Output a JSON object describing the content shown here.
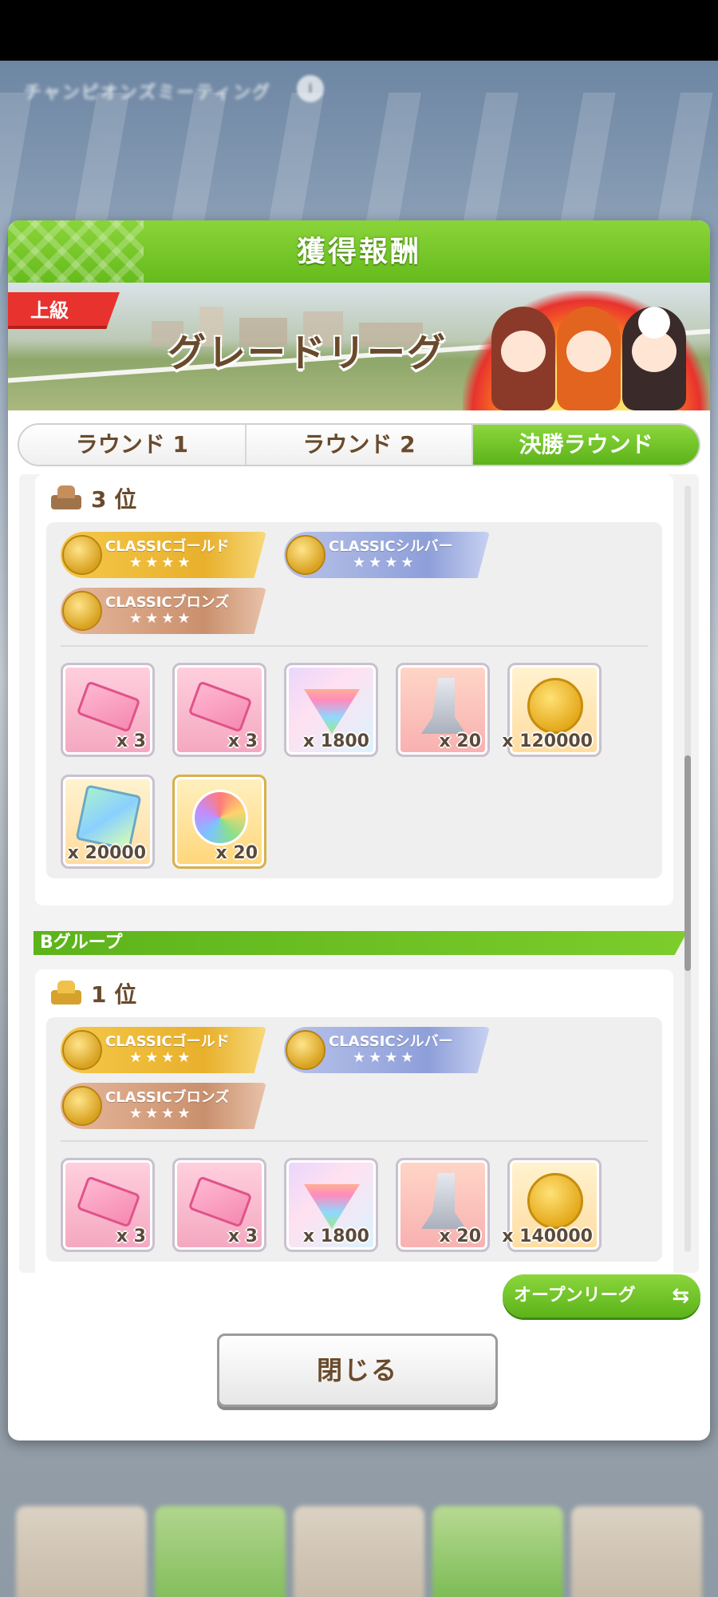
{
  "background": {
    "title": "チャンピオンズミーティング",
    "info_label": "i"
  },
  "modal": {
    "title": "獲得報酬",
    "banner": {
      "difficulty": "上級",
      "league": "グレードリーグ"
    },
    "tabs": [
      {
        "label": "ラウンド 1",
        "active": false
      },
      {
        "label": "ラウンド 2",
        "active": false
      },
      {
        "label": "決勝ラウンド",
        "active": true
      }
    ],
    "sections": [
      {
        "rank": "3 位",
        "badges": [
          {
            "name": "CLASSICゴールド",
            "stars": "★★★★"
          },
          {
            "name": "CLASSICシルバー",
            "stars": "★★★★"
          },
          {
            "name": "CLASSICブロンズ",
            "stars": "★★★★"
          }
        ],
        "items": [
          {
            "icon": "pink-ticket-icon",
            "qty": "x 3"
          },
          {
            "icon": "pink-ticket-icon",
            "qty": "x 3"
          },
          {
            "icon": "rainbow-carrot-icon",
            "qty": "x 1800"
          },
          {
            "icon": "horse-statue-icon",
            "qty": "x 20"
          },
          {
            "icon": "gold-coin-icon",
            "qty": "x 120000"
          },
          {
            "icon": "support-card-piece-icon",
            "qty": "x 20000"
          },
          {
            "icon": "rainbow-horseshoe-icon",
            "qty": "x 20"
          }
        ]
      },
      {
        "group": "Bグループ",
        "rank": "1 位",
        "badges": [
          {
            "name": "CLASSICゴールド",
            "stars": "★★★★"
          },
          {
            "name": "CLASSICシルバー",
            "stars": "★★★★"
          },
          {
            "name": "CLASSICブロンズ",
            "stars": "★★★★"
          }
        ],
        "items": [
          {
            "icon": "pink-ticket-icon",
            "qty": "x 3"
          },
          {
            "icon": "pink-ticket-icon",
            "qty": "x 3"
          },
          {
            "icon": "rainbow-carrot-icon",
            "qty": "x 1800"
          },
          {
            "icon": "horse-statue-icon",
            "qty": "x 20"
          },
          {
            "icon": "gold-coin-icon",
            "qty": "x 140000"
          }
        ]
      }
    ],
    "switch_button": "オープンリーグ",
    "switch_icon": "⇆",
    "close_button": "閉じる"
  },
  "colors": {
    "accent_green": "#66bb1c",
    "text_brown": "#6a4a2c",
    "badge_red": "#e8322e"
  }
}
